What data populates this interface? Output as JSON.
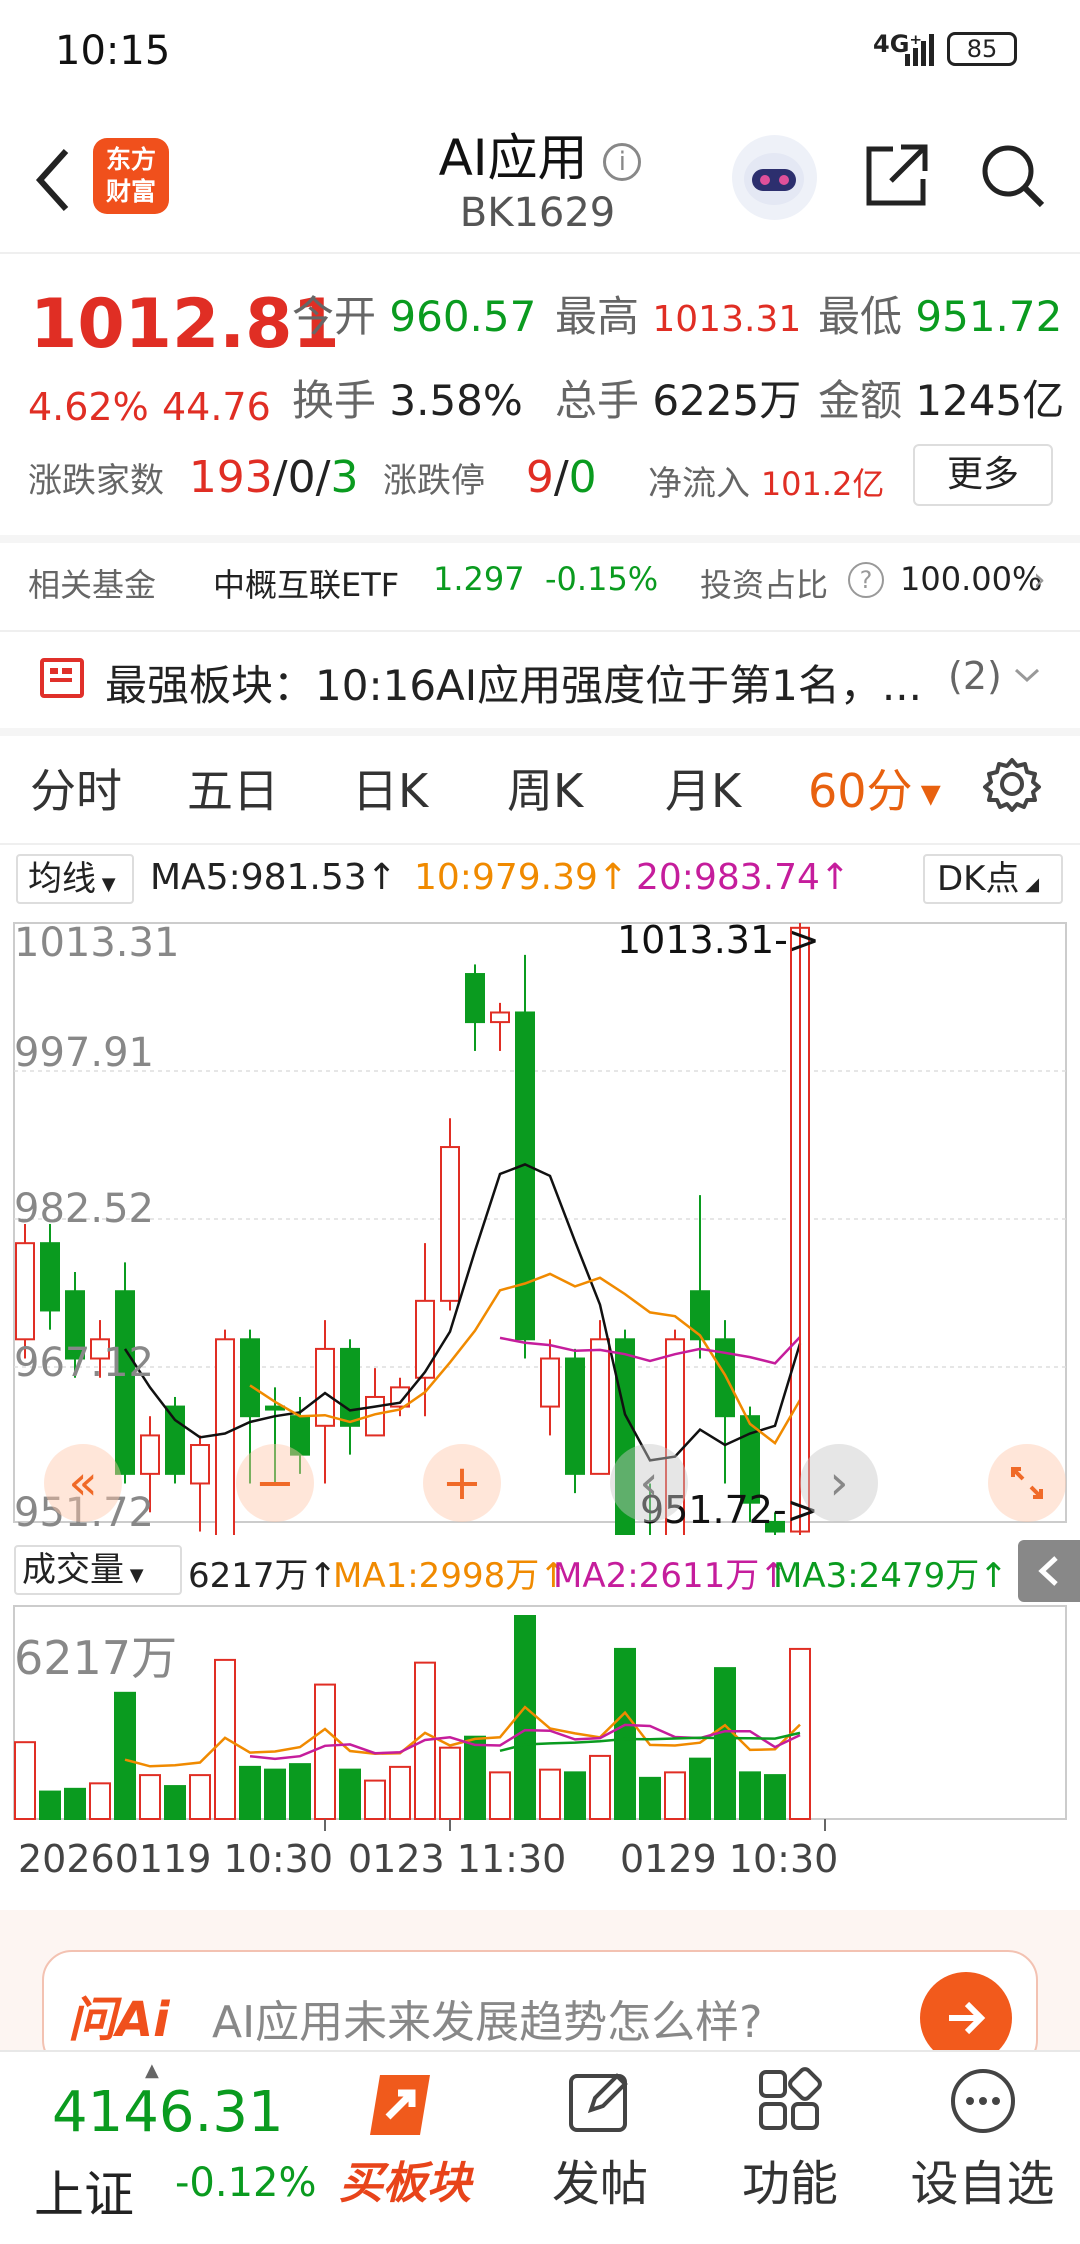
{
  "status_bar": {
    "time": "10:15",
    "network": "4G⁺",
    "battery": "85"
  },
  "header": {
    "title": "AI应用",
    "code": "BK1629",
    "logo_text": "东方财富"
  },
  "quote": {
    "price": "1012.81",
    "change_pct": "4.62%",
    "change": "44.76",
    "open_label": "今开",
    "open": "960.57",
    "high_label": "最高",
    "high": "1013.31",
    "low_label": "最低",
    "low": "951.72",
    "turnover_label": "换手",
    "turnover": "3.58%",
    "volume_label": "总手",
    "volume": "6225万",
    "amount_label": "金额",
    "amount": "1245亿",
    "breadth_label": "涨跌家数",
    "breadth_up": "193",
    "breadth_flat": "0",
    "breadth_down": "3",
    "limit_label": "涨跌停",
    "limit_up": "9",
    "limit_down": "0",
    "inflow_label": "净流入",
    "inflow": "101.2亿",
    "more_button": "更多"
  },
  "fund": {
    "label": "相关基金",
    "name": "中概互联ETF",
    "price": "1.297",
    "change": "-0.15%",
    "ratio_label": "投资占比",
    "ratio": "100.00%"
  },
  "notice": {
    "text": "最强板块：10:16AI应用强度位于第1名，...",
    "count": "(2)"
  },
  "tabs": [
    "分时",
    "五日",
    "日K",
    "周K",
    "月K",
    "60分"
  ],
  "ma_bar": {
    "selector": "均线",
    "ma5": "MA5:981.53↑",
    "ma10": "10:979.39↑",
    "ma20": "20:983.74↑",
    "dk": "DK点"
  },
  "kline": {
    "y_labels": [
      "1013.31",
      "997.91",
      "982.52",
      "967.12",
      "951.72"
    ],
    "high_mark": "1013.31->",
    "low_mark": "951.72->",
    "candles": [
      {
        "o": 970,
        "c": 980,
        "h": 982,
        "l": 968,
        "up": true
      },
      {
        "o": 980,
        "c": 973,
        "h": 982,
        "l": 971,
        "up": false
      },
      {
        "o": 975,
        "c": 968,
        "h": 977,
        "l": 966,
        "up": false
      },
      {
        "o": 970,
        "c": 968,
        "h": 972,
        "l": 966,
        "up": true
      },
      {
        "o": 975,
        "c": 956,
        "h": 978,
        "l": 955,
        "up": false
      },
      {
        "o": 956,
        "c": 960,
        "h": 962,
        "l": 952,
        "up": true
      },
      {
        "o": 963,
        "c": 956,
        "h": 964,
        "l": 955,
        "up": false
      },
      {
        "o": 955,
        "c": 959,
        "h": 960,
        "l": 950,
        "up": true
      },
      {
        "o": 947,
        "c": 970,
        "h": 971,
        "l": 945,
        "up": true
      },
      {
        "o": 970,
        "c": 962,
        "h": 971,
        "l": 955,
        "up": false
      },
      {
        "o": 963,
        "c": 963,
        "h": 965,
        "l": 955,
        "up": false
      },
      {
        "o": 962,
        "c": 958,
        "h": 964,
        "l": 956,
        "up": false
      },
      {
        "o": 961,
        "c": 969,
        "h": 972,
        "l": 955,
        "up": true
      },
      {
        "o": 969,
        "c": 961,
        "h": 970,
        "l": 958,
        "up": false
      },
      {
        "o": 960,
        "c": 964,
        "h": 967,
        "l": 961,
        "up": true
      },
      {
        "o": 963,
        "c": 965,
        "h": 966,
        "l": 962,
        "up": true
      },
      {
        "o": 966,
        "c": 974,
        "h": 980,
        "l": 962,
        "up": true
      },
      {
        "o": 974,
        "c": 990,
        "h": 993,
        "l": 973,
        "up": true
      },
      {
        "o": 1008,
        "c": 1003,
        "h": 1009,
        "l": 1000,
        "up": false
      },
      {
        "o": 1003,
        "c": 1004,
        "h": 1005,
        "l": 1000,
        "up": true
      },
      {
        "o": 1004,
        "c": 970,
        "h": 1010,
        "l": 968,
        "up": false
      },
      {
        "o": 963,
        "c": 968,
        "h": 970,
        "l": 960,
        "up": true
      },
      {
        "o": 968,
        "c": 956,
        "h": 969,
        "l": 954,
        "up": false
      },
      {
        "o": 956,
        "c": 970,
        "h": 972,
        "l": 956,
        "up": true
      },
      {
        "o": 970,
        "c": 947,
        "h": 971,
        "l": 943,
        "up": false
      },
      {
        "o": 946,
        "c": 946,
        "h": 955,
        "l": 941,
        "up": false
      },
      {
        "o": 945,
        "c": 970,
        "h": 971,
        "l": 944,
        "up": true
      },
      {
        "o": 975,
        "c": 970,
        "h": 985,
        "l": 968,
        "up": false
      },
      {
        "o": 970,
        "c": 962,
        "h": 972,
        "l": 955,
        "up": false
      },
      {
        "o": 962,
        "c": 953,
        "h": 963,
        "l": 951,
        "up": false
      },
      {
        "o": 951,
        "c": 950,
        "h": 952,
        "l": 949,
        "up": false
      },
      {
        "o": 950,
        "c": 1012.81,
        "h": 1013.31,
        "l": 950,
        "up": true
      }
    ]
  },
  "volume": {
    "selector": "成交量",
    "value": "6217万↑",
    "ma1": "MA1:2998万↑",
    "ma2": "MA2:2611万↑",
    "ma3": "MA3:2479万↑",
    "y_label": "6217万",
    "bars": [
      2800,
      1000,
      1100,
      1300,
      4600,
      1600,
      1200,
      1600,
      5800,
      1900,
      1800,
      2000,
      4900,
      1800,
      1400,
      1900,
      5700,
      2600,
      3000,
      1700,
      7400,
      1800,
      1700,
      2300,
      6200,
      1500,
      1700,
      2200,
      5500,
      1700,
      1600,
      6200
    ]
  },
  "x_labels": [
    "20260119 10:30",
    "0123 11:30",
    "0129 10:30"
  ],
  "ai_bar": {
    "brand": "问Ai",
    "question": "AI应用未来发展趋势怎么样?"
  },
  "bottom": {
    "index_value": "4146.31",
    "index_name": "上证",
    "index_change": "-0.12%",
    "buy": "买板块",
    "post": "发帖",
    "func": "功能",
    "watch": "设自选"
  },
  "colors": {
    "red": "#e02e24",
    "green": "#0a9b1f",
    "orange": "#f08a00",
    "magenta": "#c51d9c"
  }
}
